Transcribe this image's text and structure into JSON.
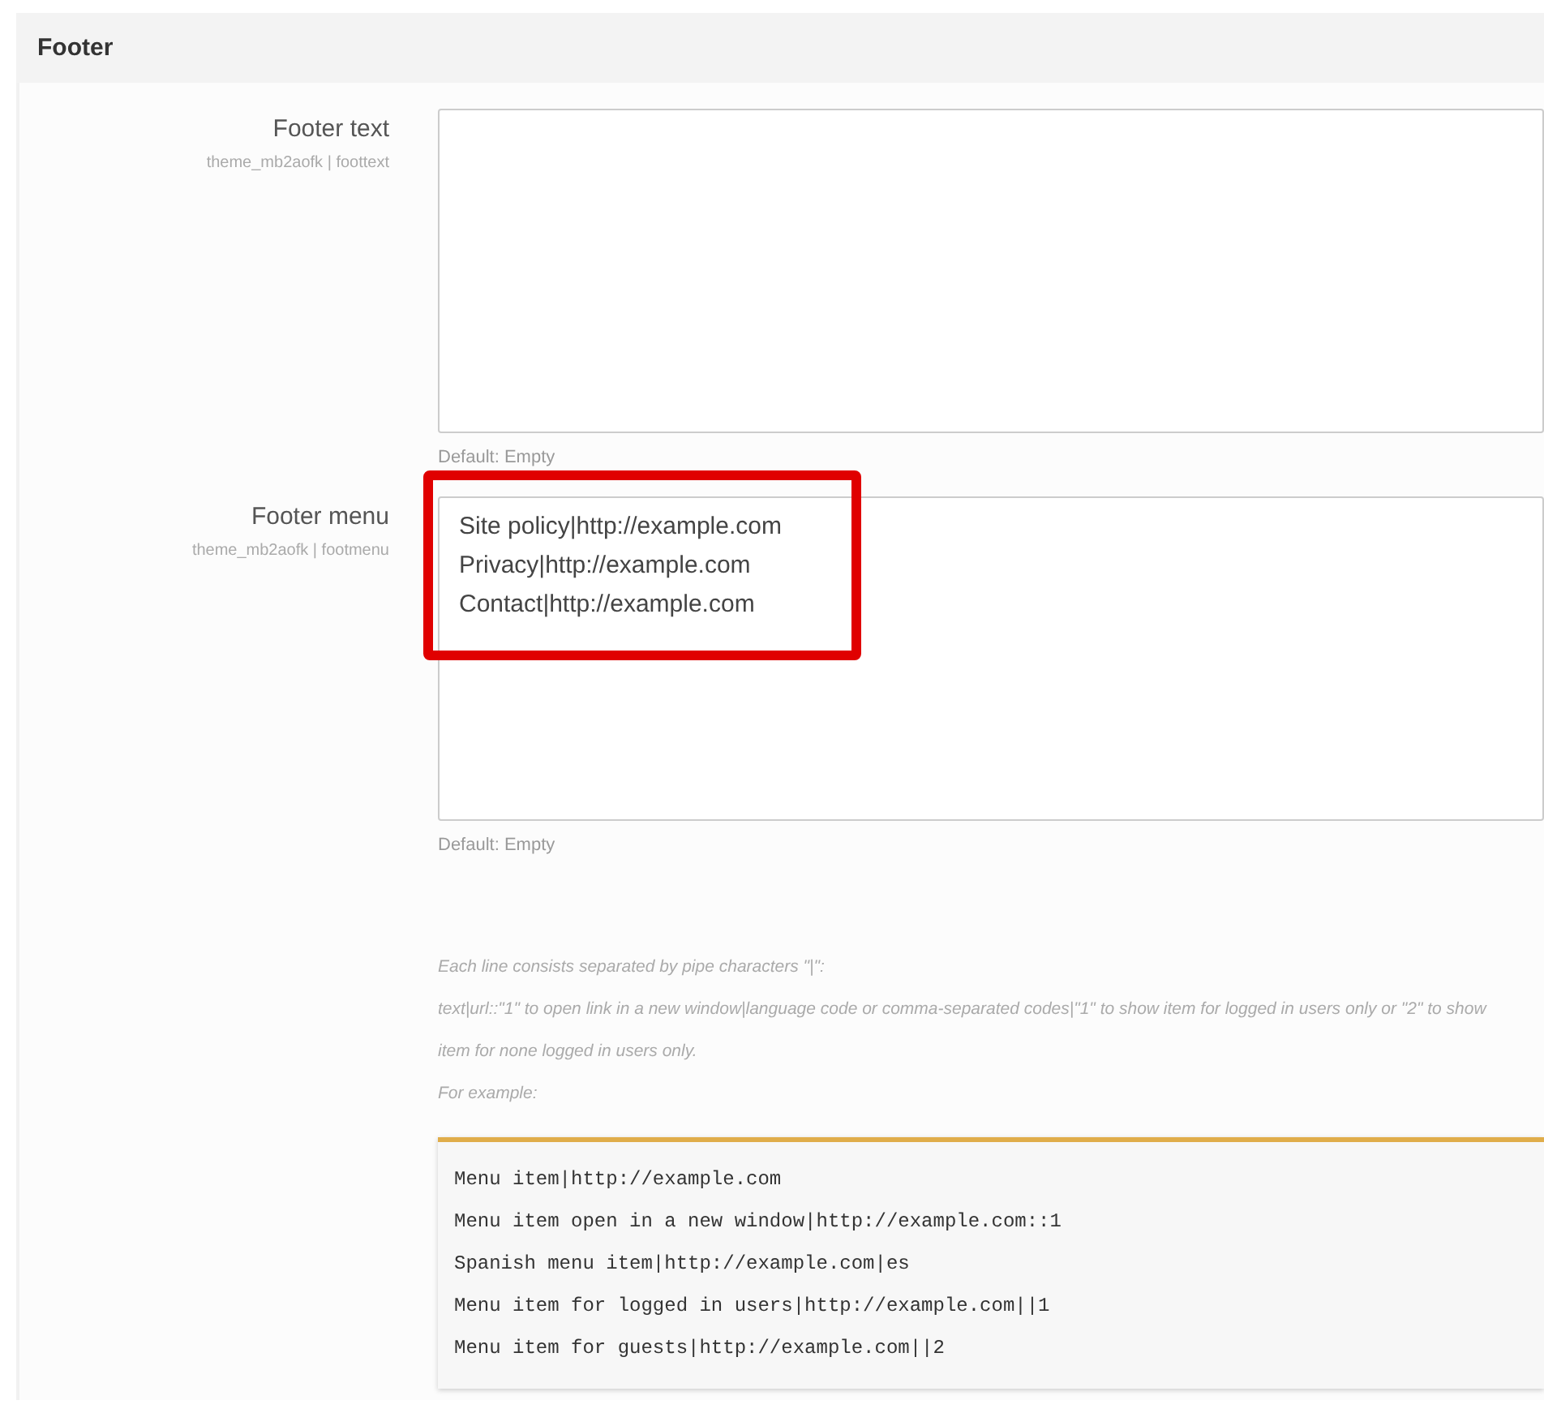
{
  "section": {
    "title": "Footer"
  },
  "settings": [
    {
      "label": "Footer text",
      "setting_id": "theme_mb2aofk | foottext",
      "default": "Default: Empty",
      "highlighted": false
    },
    {
      "label": "Footer menu",
      "setting_id": "theme_mb2aofk | footmenu",
      "value_lines": [
        "Site policy|http://example.com",
        "Privacy|http://example.com",
        "Contact|http://example.com"
      ],
      "default": "Default: Empty",
      "highlighted": true,
      "help": [
        "Each line consists separated by pipe characters \"|\":",
        "text|url::\"1\" to open link in a new window|language code or comma-separated codes|\"1\" to show item for logged in users only or \"2\" to show item for none logged in users only.",
        "For example:"
      ],
      "example_lines": [
        "Menu item|http://example.com",
        "Menu item open in a new window|http://example.com::1",
        "Spanish menu item|http://example.com|es",
        "Menu item for logged in users|http://example.com||1",
        "Menu item for guests|http://example.com||2"
      ]
    }
  ]
}
